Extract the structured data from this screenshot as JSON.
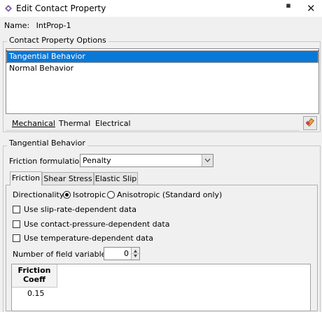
{
  "window": {
    "title": "Edit Contact Property"
  },
  "name": {
    "label": "Name:",
    "value": "IntProp-1"
  },
  "options": {
    "group_label": "Contact Property Options",
    "items": [
      "Tangential Behavior",
      "Normal Behavior"
    ],
    "selected": "Tangential Behavior"
  },
  "menu": {
    "mechanical": "Mechanical",
    "thermal": "Thermal",
    "electrical": "Electrical"
  },
  "section": {
    "title": "Tangential Behavior",
    "friction_label": "Friction formulation:",
    "friction_value": "Penalty"
  },
  "tabs": [
    "Friction",
    "Shear Stress",
    "Elastic Slip"
  ],
  "friction": {
    "directionality_label": "Directionality:",
    "isotropic": "Isotropic",
    "anisotropic": "Anisotropic (Standard only)",
    "cb_slip": "Use slip-rate-dependent data",
    "cb_pressure": "Use contact-pressure-dependent data",
    "cb_temp": "Use temperature-dependent data",
    "field_vars_label": "Number of field variables:",
    "field_vars_value": "0",
    "table_header_1": "Friction",
    "table_header_2": "Coeff",
    "table_value": "0.15"
  }
}
